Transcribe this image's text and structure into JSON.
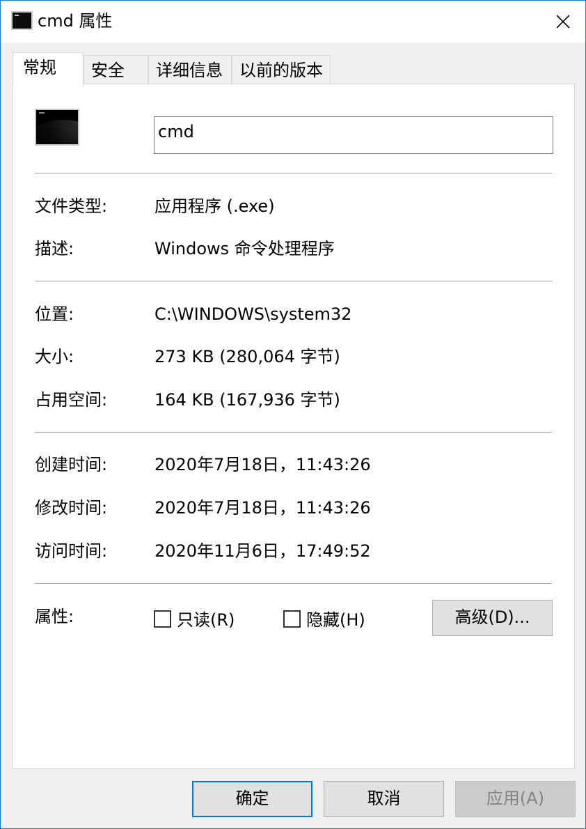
{
  "window": {
    "title": "cmd 属性"
  },
  "tabs": [
    {
      "label": "常规",
      "active": true
    },
    {
      "label": "安全",
      "active": false
    },
    {
      "label": "详细信息",
      "active": false
    },
    {
      "label": "以前的版本",
      "active": false
    }
  ],
  "general": {
    "name_value": "cmd",
    "file_type": {
      "label": "文件类型:",
      "value": "应用程序 (.exe)"
    },
    "description": {
      "label": "描述:",
      "value": "Windows 命令处理程序"
    },
    "location": {
      "label": "位置:",
      "value": "C:\\WINDOWS\\system32"
    },
    "size": {
      "label": "大小:",
      "value": "273 KB (280,064 字节)"
    },
    "size_on_disk": {
      "label": "占用空间:",
      "value": "164 KB (167,936 字节)"
    },
    "created": {
      "label": "创建时间:",
      "value": "2020年7月18日，11:43:26"
    },
    "modified": {
      "label": "修改时间:",
      "value": "2020年7月18日，11:43:26"
    },
    "accessed": {
      "label": "访问时间:",
      "value": "2020年11月6日，17:49:52"
    },
    "attributes": {
      "label": "属性:",
      "readonly_label": "只读(R)",
      "readonly_checked": false,
      "hidden_label": "隐藏(H)",
      "hidden_checked": false,
      "advanced_label": "高级(D)..."
    }
  },
  "footer": {
    "ok_label": "确定",
    "cancel_label": "取消",
    "apply_label": "应用(A)"
  },
  "colors": {
    "accent": "#0078d7",
    "panel": "#ffffff",
    "chrome": "#f0f0f0"
  },
  "icons": {
    "title": "console-icon",
    "close": "close-icon",
    "file": "console-icon"
  }
}
